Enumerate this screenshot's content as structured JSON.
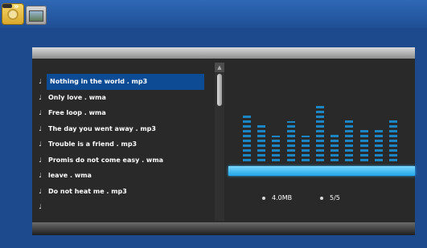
{
  "top_icons": [
    {
      "name": "music-icon"
    },
    {
      "name": "photo-icon"
    }
  ],
  "playlist": {
    "tracks": [
      {
        "name": "Nothing in the world . mp3",
        "selected": true
      },
      {
        "name": "Only love . wma"
      },
      {
        "name": "Free loop . wma"
      },
      {
        "name": "The day you went away . mp3"
      },
      {
        "name": "Trouble is a friend . mp3"
      },
      {
        "name": "Promis do not come easy . wma"
      },
      {
        "name": "leave . wma"
      },
      {
        "name": "Do not heat me . mp3"
      },
      {
        "name": ""
      }
    ]
  },
  "equalizer": {
    "levels": [
      0.82,
      0.65,
      0.45,
      0.7,
      0.45,
      1.0,
      0.5,
      0.71,
      0.55,
      0.55,
      0.71
    ],
    "color": "#1c86c5"
  },
  "file_info": {
    "size": "4.0MB",
    "position": "5/5"
  },
  "colors": {
    "background": "#1d4a8c",
    "panel": "#2a2929",
    "selection": "#0d4b94",
    "accent": "#20a5ea"
  }
}
